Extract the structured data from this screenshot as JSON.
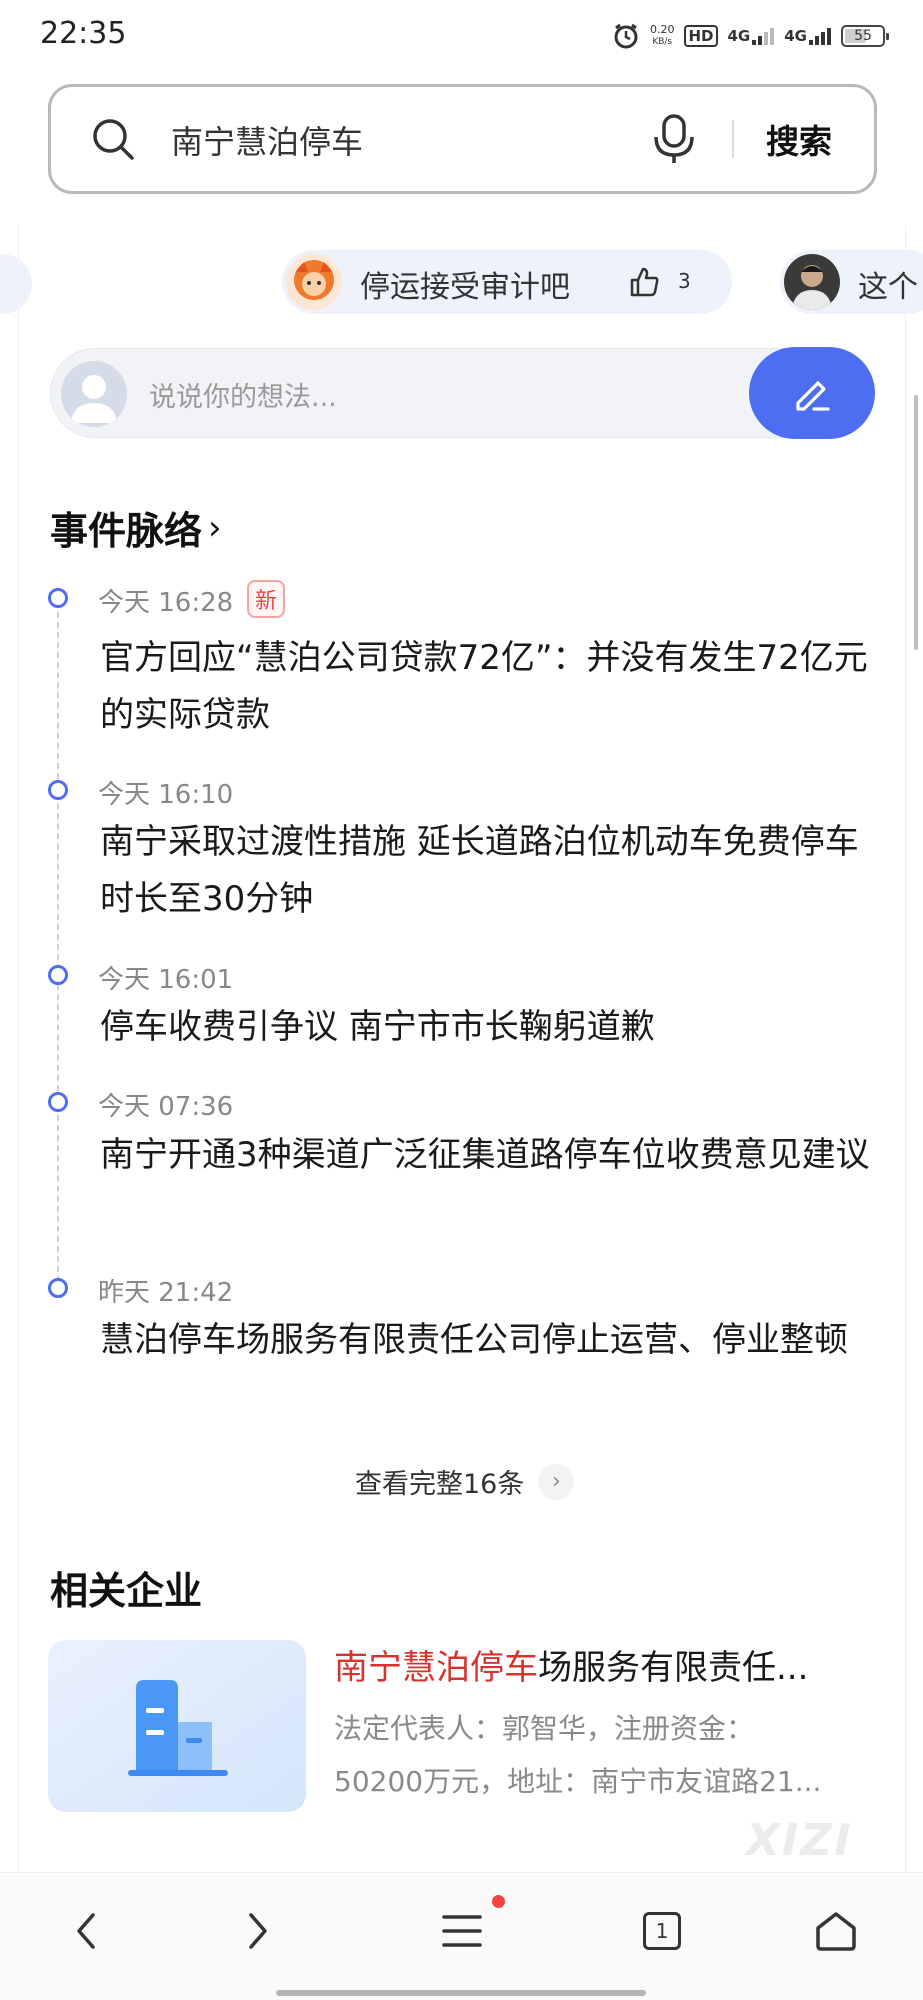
{
  "status_bar": {
    "time": "22:35",
    "net_speed_value": "0.20",
    "net_speed_unit": "KB/s",
    "hd_label": "HD",
    "signal_1_label": "4G",
    "signal_2_label": "4G",
    "battery_level": "55",
    "icons": [
      "alarm-icon",
      "hd-icon",
      "signal-icon",
      "signal-icon",
      "battery-icon"
    ]
  },
  "search": {
    "query": "南宁慧泊停车",
    "button_label": "搜索",
    "icons": [
      "search-icon",
      "mic-icon"
    ]
  },
  "comment_chips": [
    {
      "text": "停运接受审计吧",
      "likes": "3"
    },
    {
      "text": "这个"
    }
  ],
  "comment_input": {
    "placeholder": "说说你的想法..."
  },
  "timeline": {
    "title": "事件脉络",
    "arrow": "›",
    "new_badge": "新",
    "items": [
      {
        "time": "今天 16:28",
        "title": "官方回应“慧泊公司贷款72亿”：并没有发生72亿元的实际贷款"
      },
      {
        "time": "今天 16:10",
        "title": "南宁采取过渡性措施 延长道路泊位机动车免费停车时长至30分钟"
      },
      {
        "time": "今天 16:01",
        "title": "停车收费引争议 南宁市市长鞠躬道歉"
      },
      {
        "time": "今天 07:36",
        "title": "南宁开通3种渠道广泛征集道路停车位收费意见建议"
      },
      {
        "time": "昨天 21:42",
        "title": "慧泊停车场服务有限责任公司停止运营、停业整顿"
      }
    ],
    "view_all": "查看完整16条",
    "view_all_arrow": "›"
  },
  "related": {
    "title": "相关企业",
    "company": {
      "name_highlight": "南宁慧泊停车",
      "name_rest": "场服务有限责任...",
      "desc_line1": "法定代表人：郭智华，注册资金：",
      "desc_line2": "50200万元，地址：南宁市友谊路21..."
    }
  },
  "watermark": "XIZI",
  "bottom_nav": {
    "tab_count": "1",
    "icons": [
      "back-icon",
      "forward-icon",
      "menu-icon",
      "tabs-icon",
      "home-icon"
    ]
  },
  "colors": {
    "accent": "#4e6ef2",
    "highlight_red": "#d8322e",
    "chip_bg": "#eef2fb"
  }
}
